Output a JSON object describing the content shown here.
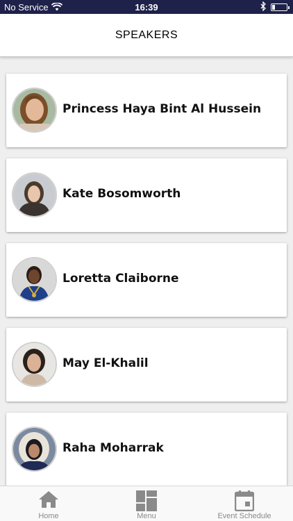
{
  "status_bar": {
    "carrier": "No Service",
    "time": "16:39",
    "bluetooth_icon": "bluetooth-icon",
    "wifi_icon": "wifi-icon",
    "battery_level": 0.2
  },
  "header": {
    "title": "SPEAKERS"
  },
  "speakers": [
    {
      "name": "Princess Haya Bint Al Hussein"
    },
    {
      "name": "Kate Bosomworth"
    },
    {
      "name": "Loretta Claiborne"
    },
    {
      "name": "May El-Khalil"
    },
    {
      "name": "Raha Moharrak"
    }
  ],
  "tab_bar": {
    "items": [
      {
        "label": "Home",
        "icon": "home-icon"
      },
      {
        "label": "Menu",
        "icon": "grid-icon"
      },
      {
        "label": "Event Schedule",
        "icon": "calendar-icon"
      }
    ]
  },
  "colors": {
    "status_bar_bg": "#1e2149",
    "page_bg": "#efefef",
    "tab_icon": "#8a8a8a"
  }
}
